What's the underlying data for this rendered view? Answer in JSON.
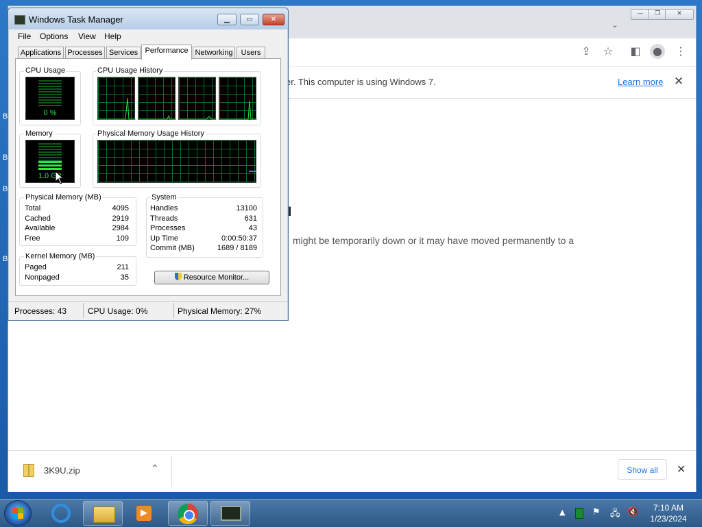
{
  "chrome": {
    "infobar_message": "er. This computer is using Windows 7.",
    "learn_more": "Learn more",
    "close_glyph": "✕",
    "page_error_fragment": " might be temporarily down or it may have moved permanently to a",
    "page_heading_fragment": "I",
    "download": {
      "filename": "3K9U.zip",
      "show_all": "Show all"
    },
    "icons": [
      "share-icon",
      "star-icon",
      "sidepanel-icon",
      "profile-icon",
      "menu-icon"
    ]
  },
  "desktop_edge_labels": [
    "B",
    "B",
    "B",
    "B"
  ],
  "task_manager": {
    "title": "Windows Task Manager",
    "menu": [
      "File",
      "Options",
      "View",
      "Help"
    ],
    "tabs": [
      "Applications",
      "Processes",
      "Services",
      "Performance",
      "Networking",
      "Users"
    ],
    "active_tab": "Performance",
    "cpu_usage_label": "CPU Usage",
    "cpu_usage_value": "0 %",
    "cpu_history_label": "CPU Usage History",
    "memory_label": "Memory",
    "memory_value": "1.0 GB",
    "phys_history_label": "Physical Memory Usage History",
    "physical_memory": {
      "label": "Physical Memory (MB)",
      "rows": [
        {
          "name": "Total",
          "value": "4095"
        },
        {
          "name": "Cached",
          "value": "2919"
        },
        {
          "name": "Available",
          "value": "2984"
        },
        {
          "name": "Free",
          "value": "109"
        }
      ]
    },
    "kernel_memory": {
      "label": "Kernel Memory (MB)",
      "rows": [
        {
          "name": "Paged",
          "value": "211"
        },
        {
          "name": "Nonpaged",
          "value": "35"
        }
      ]
    },
    "system": {
      "label": "System",
      "rows": [
        {
          "name": "Handles",
          "value": "13100"
        },
        {
          "name": "Threads",
          "value": "631"
        },
        {
          "name": "Processes",
          "value": "43"
        },
        {
          "name": "Up Time",
          "value": "0:00:50:37"
        },
        {
          "name": "Commit (MB)",
          "value": "1689 / 8189"
        }
      ]
    },
    "resource_monitor_button": "Resource Monitor...",
    "status": {
      "processes": "Processes: 43",
      "cpu": "CPU Usage: 0%",
      "memory": "Physical Memory: 27%"
    },
    "cpu_level": 0.0,
    "memory_level": 0.27
  },
  "taskbar": {
    "time": "7:10 AM",
    "date": "1/23/2024",
    "pinned": [
      "internet-explorer",
      "windows-explorer",
      "media-player",
      "chrome",
      "task-manager"
    ]
  },
  "colors": {
    "graph_green": "#21e63c",
    "grid_green": "#0b6b2a",
    "link_blue": "#1a73e8"
  }
}
